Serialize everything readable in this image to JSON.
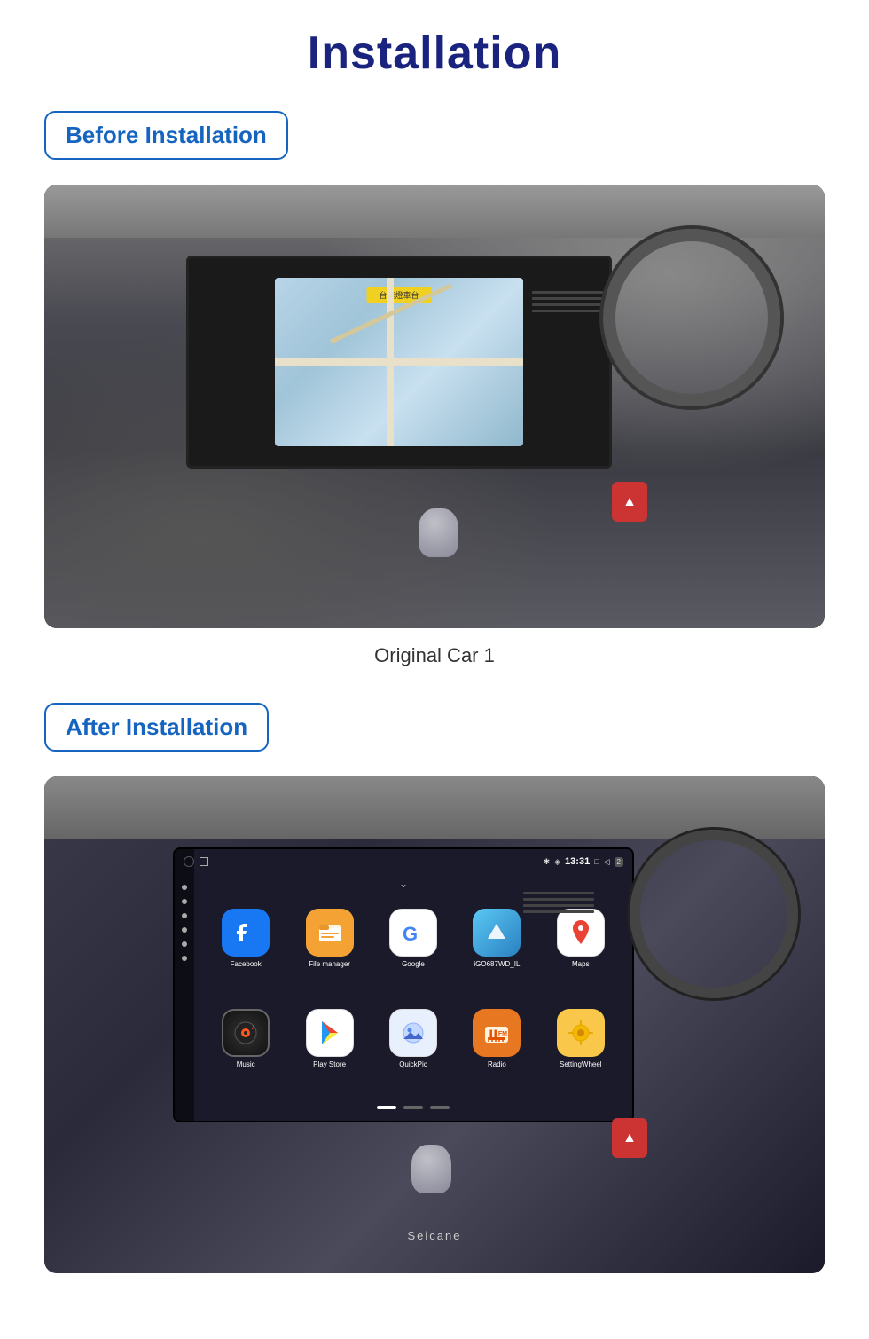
{
  "page": {
    "title": "Installation",
    "sections": [
      {
        "id": "before",
        "label": "Before Installation",
        "caption": "Original Car  1"
      },
      {
        "id": "after",
        "label": "After Installation",
        "seicane": "Seicane"
      }
    ]
  },
  "android_screen": {
    "status_bar": {
      "time": "13:31",
      "icons": "* ◈ □ ◁ 2"
    },
    "apps": [
      {
        "name": "Facebook",
        "icon": "facebook",
        "color": "#1877f2"
      },
      {
        "name": "File manager",
        "icon": "filemanager",
        "color": "#f4a234"
      },
      {
        "name": "Google",
        "icon": "google",
        "color": "#fff"
      },
      {
        "name": "iGO687WD_IL",
        "icon": "igo",
        "color": "#3a9ad9"
      },
      {
        "name": "Maps",
        "icon": "maps",
        "color": "#fff"
      },
      {
        "name": "Music",
        "icon": "music",
        "color": "#222"
      },
      {
        "name": "Play Store",
        "icon": "playstore",
        "color": "#fff"
      },
      {
        "name": "QuickPic",
        "icon": "quickpic",
        "color": "#f5f5ff"
      },
      {
        "name": "Radio",
        "icon": "radio",
        "color": "#e87722"
      },
      {
        "name": "SettingWheel",
        "icon": "settingwheel",
        "color": "#f9c84a"
      }
    ]
  },
  "colors": {
    "title": "#1a237e",
    "section_label_border": "#1565c0",
    "section_label_text": "#1565c0"
  }
}
